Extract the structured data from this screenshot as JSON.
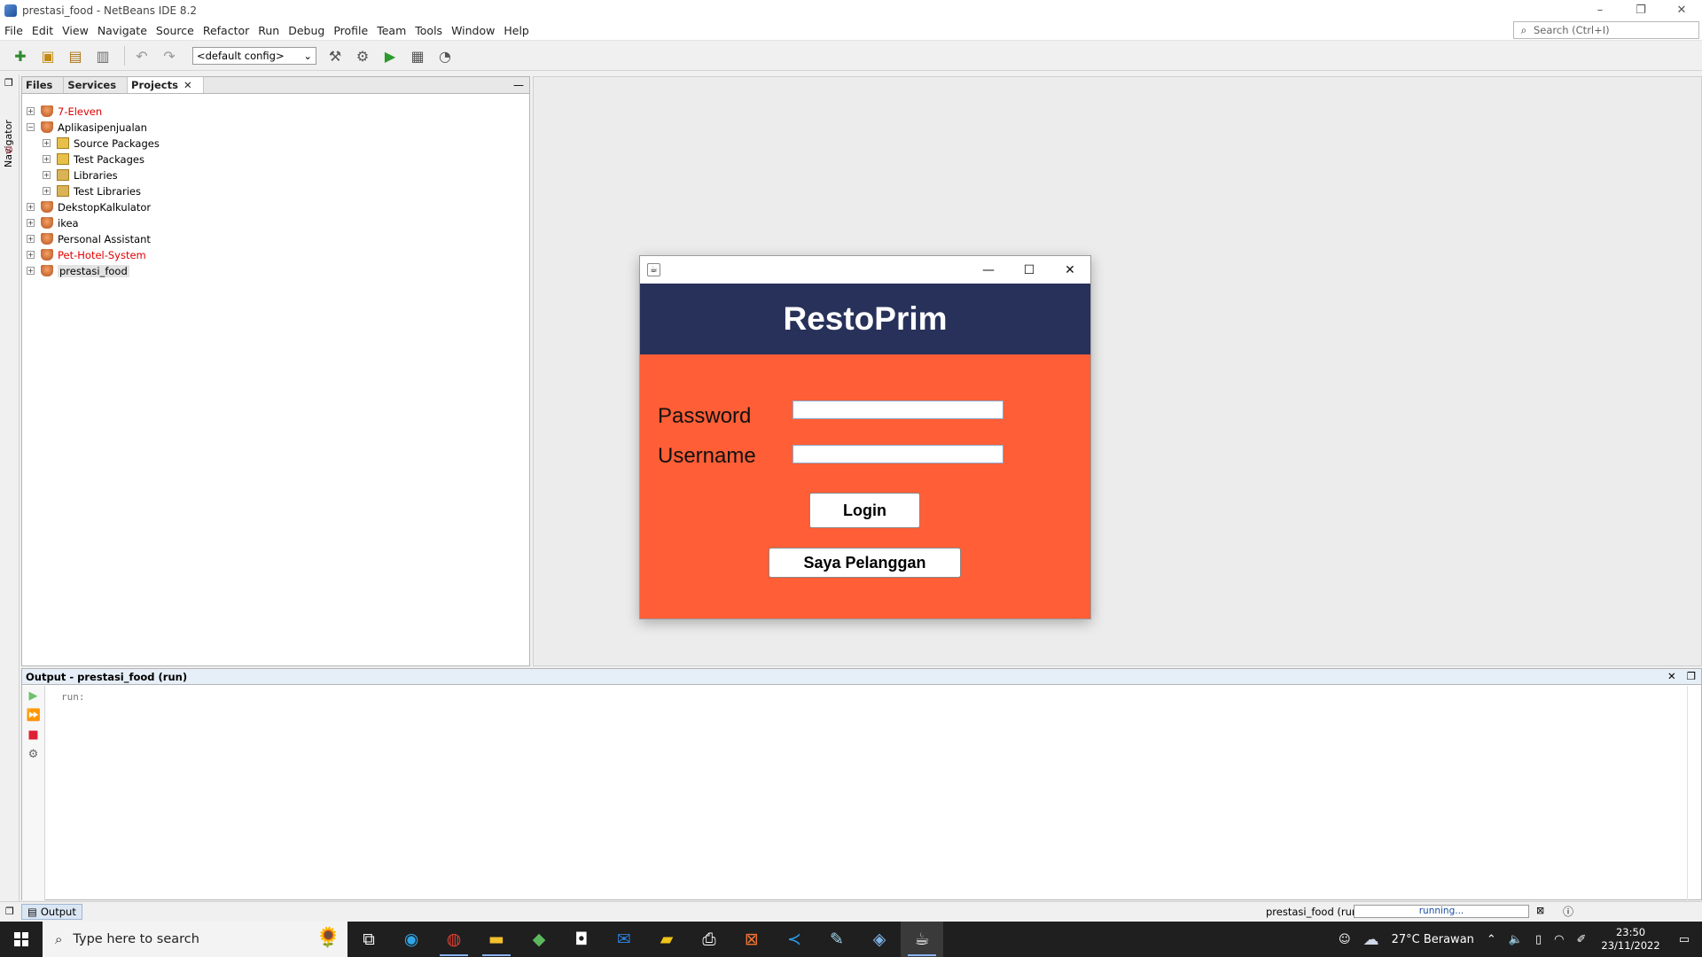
{
  "window": {
    "title": "prestasi_food - NetBeans IDE 8.2",
    "controls": [
      "–",
      "❐",
      "✕"
    ]
  },
  "menu": [
    "File",
    "Edit",
    "View",
    "Navigate",
    "Source",
    "Refactor",
    "Run",
    "Debug",
    "Profile",
    "Team",
    "Tools",
    "Window",
    "Help"
  ],
  "search": {
    "placeholder": "Search (Ctrl+I)"
  },
  "toolbar": {
    "config_value": "<default config>"
  },
  "navigator": {
    "label": "Navigator"
  },
  "projects_panel": {
    "tabs": [
      {
        "label": "Files"
      },
      {
        "label": "Services"
      },
      {
        "label": "Projects",
        "close": "✕"
      }
    ],
    "minimize": "—",
    "tree": [
      {
        "label": "7-Eleven",
        "level": 0,
        "expander": "+",
        "icon": "project-icon",
        "error": true
      },
      {
        "label": "Aplikasipenjualan",
        "level": 0,
        "expander": "−",
        "icon": "project-icon",
        "error": false
      },
      {
        "label": "Source Packages",
        "level": 1,
        "expander": "+",
        "icon": "package-icon",
        "error": false
      },
      {
        "label": "Test Packages",
        "level": 1,
        "expander": "+",
        "icon": "package-icon",
        "error": false
      },
      {
        "label": "Libraries",
        "level": 1,
        "expander": "+",
        "icon": "library-icon",
        "error": false
      },
      {
        "label": "Test Libraries",
        "level": 1,
        "expander": "+",
        "icon": "library-icon",
        "error": false
      },
      {
        "label": "DekstopKalkulator",
        "level": 0,
        "expander": "+",
        "icon": "project-icon",
        "error": false
      },
      {
        "label": "ikea",
        "level": 0,
        "expander": "+",
        "icon": "project-icon",
        "error": false
      },
      {
        "label": "Personal Assistant",
        "level": 0,
        "expander": "+",
        "icon": "project-icon",
        "error": false
      },
      {
        "label": "Pet-Hotel-System",
        "level": 0,
        "expander": "+",
        "icon": "project-icon",
        "error": true
      },
      {
        "label": "prestasi_food",
        "level": 0,
        "expander": "+",
        "icon": "project-icon",
        "error": false,
        "selected": true
      }
    ]
  },
  "output": {
    "title": "Output - prestasi_food (run)",
    "text": "run:",
    "close": "✕",
    "restore": "❐"
  },
  "statusbar": {
    "tab_label": "Output",
    "project": "prestasi_food (run)",
    "progress_text": "running..."
  },
  "dialog": {
    "brand": "RestoPrim",
    "password_label": "Password",
    "username_label": "Username",
    "password_value": "",
    "username_value": "",
    "login_label": "Login",
    "customer_label": "Saya Pelanggan",
    "colors": {
      "header": "#283159",
      "body": "#ff5e36"
    }
  },
  "taskbar": {
    "search_placeholder": "Type here to search",
    "weather": "27°C  Berawan",
    "time": "23:50",
    "date": "23/11/2022"
  }
}
